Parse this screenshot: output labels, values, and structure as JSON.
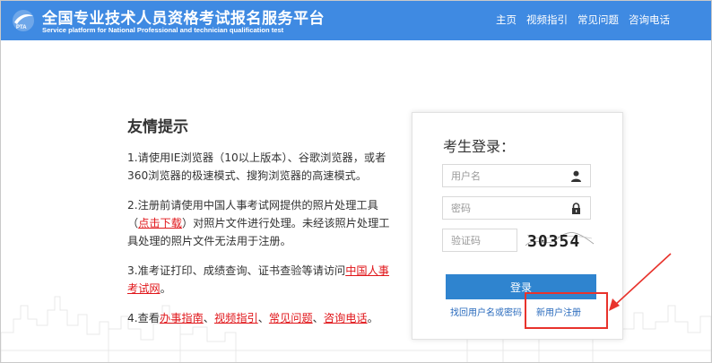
{
  "header": {
    "title": "全国专业技术人员资格考试报名服务平台",
    "subtitle": "Service platform for National Professional and technician qualification test",
    "logo_text": "PTA",
    "nav": [
      "主页",
      "视频指引",
      "常见问题",
      "咨询电话"
    ]
  },
  "tips": {
    "title": "友情提示",
    "items": [
      {
        "text": "1.请使用IE浏览器（10以上版本）、谷歌浏览器，或者360浏览器的极速模式、搜狗浏览器的高速模式。"
      },
      {
        "before": "2.注册前请使用中国人事考试网提供的照片处理工具（",
        "link": "点击下载",
        "after": "）对照片文件进行处理。未经该照片处理工具处理的照片文件无法用于注册。"
      },
      {
        "before": "3.准考证打印、成绩查询、证书查验等请访问",
        "link": "中国人事考试网",
        "after": "。"
      },
      {
        "before": "4.查看",
        "links": [
          "办事指南",
          "视频指引",
          "常见问题",
          "咨询电话"
        ],
        "sep": "、",
        "after": "。"
      }
    ]
  },
  "login": {
    "title": "考生登录：",
    "username_placeholder": "用户名",
    "password_placeholder": "密码",
    "captcha_placeholder": "验证码",
    "captcha_code": "30354",
    "submit_label": "登录",
    "recover_link": "找回用户名或密码",
    "register_link": "新用户注册"
  },
  "colors": {
    "header_bg": "#3f8ae2",
    "button_bg": "#2f84cf",
    "link_red": "#e0161a",
    "annotation_red": "#e8332c"
  },
  "icons": [
    "user-icon",
    "lock-icon",
    "logo-icon"
  ]
}
